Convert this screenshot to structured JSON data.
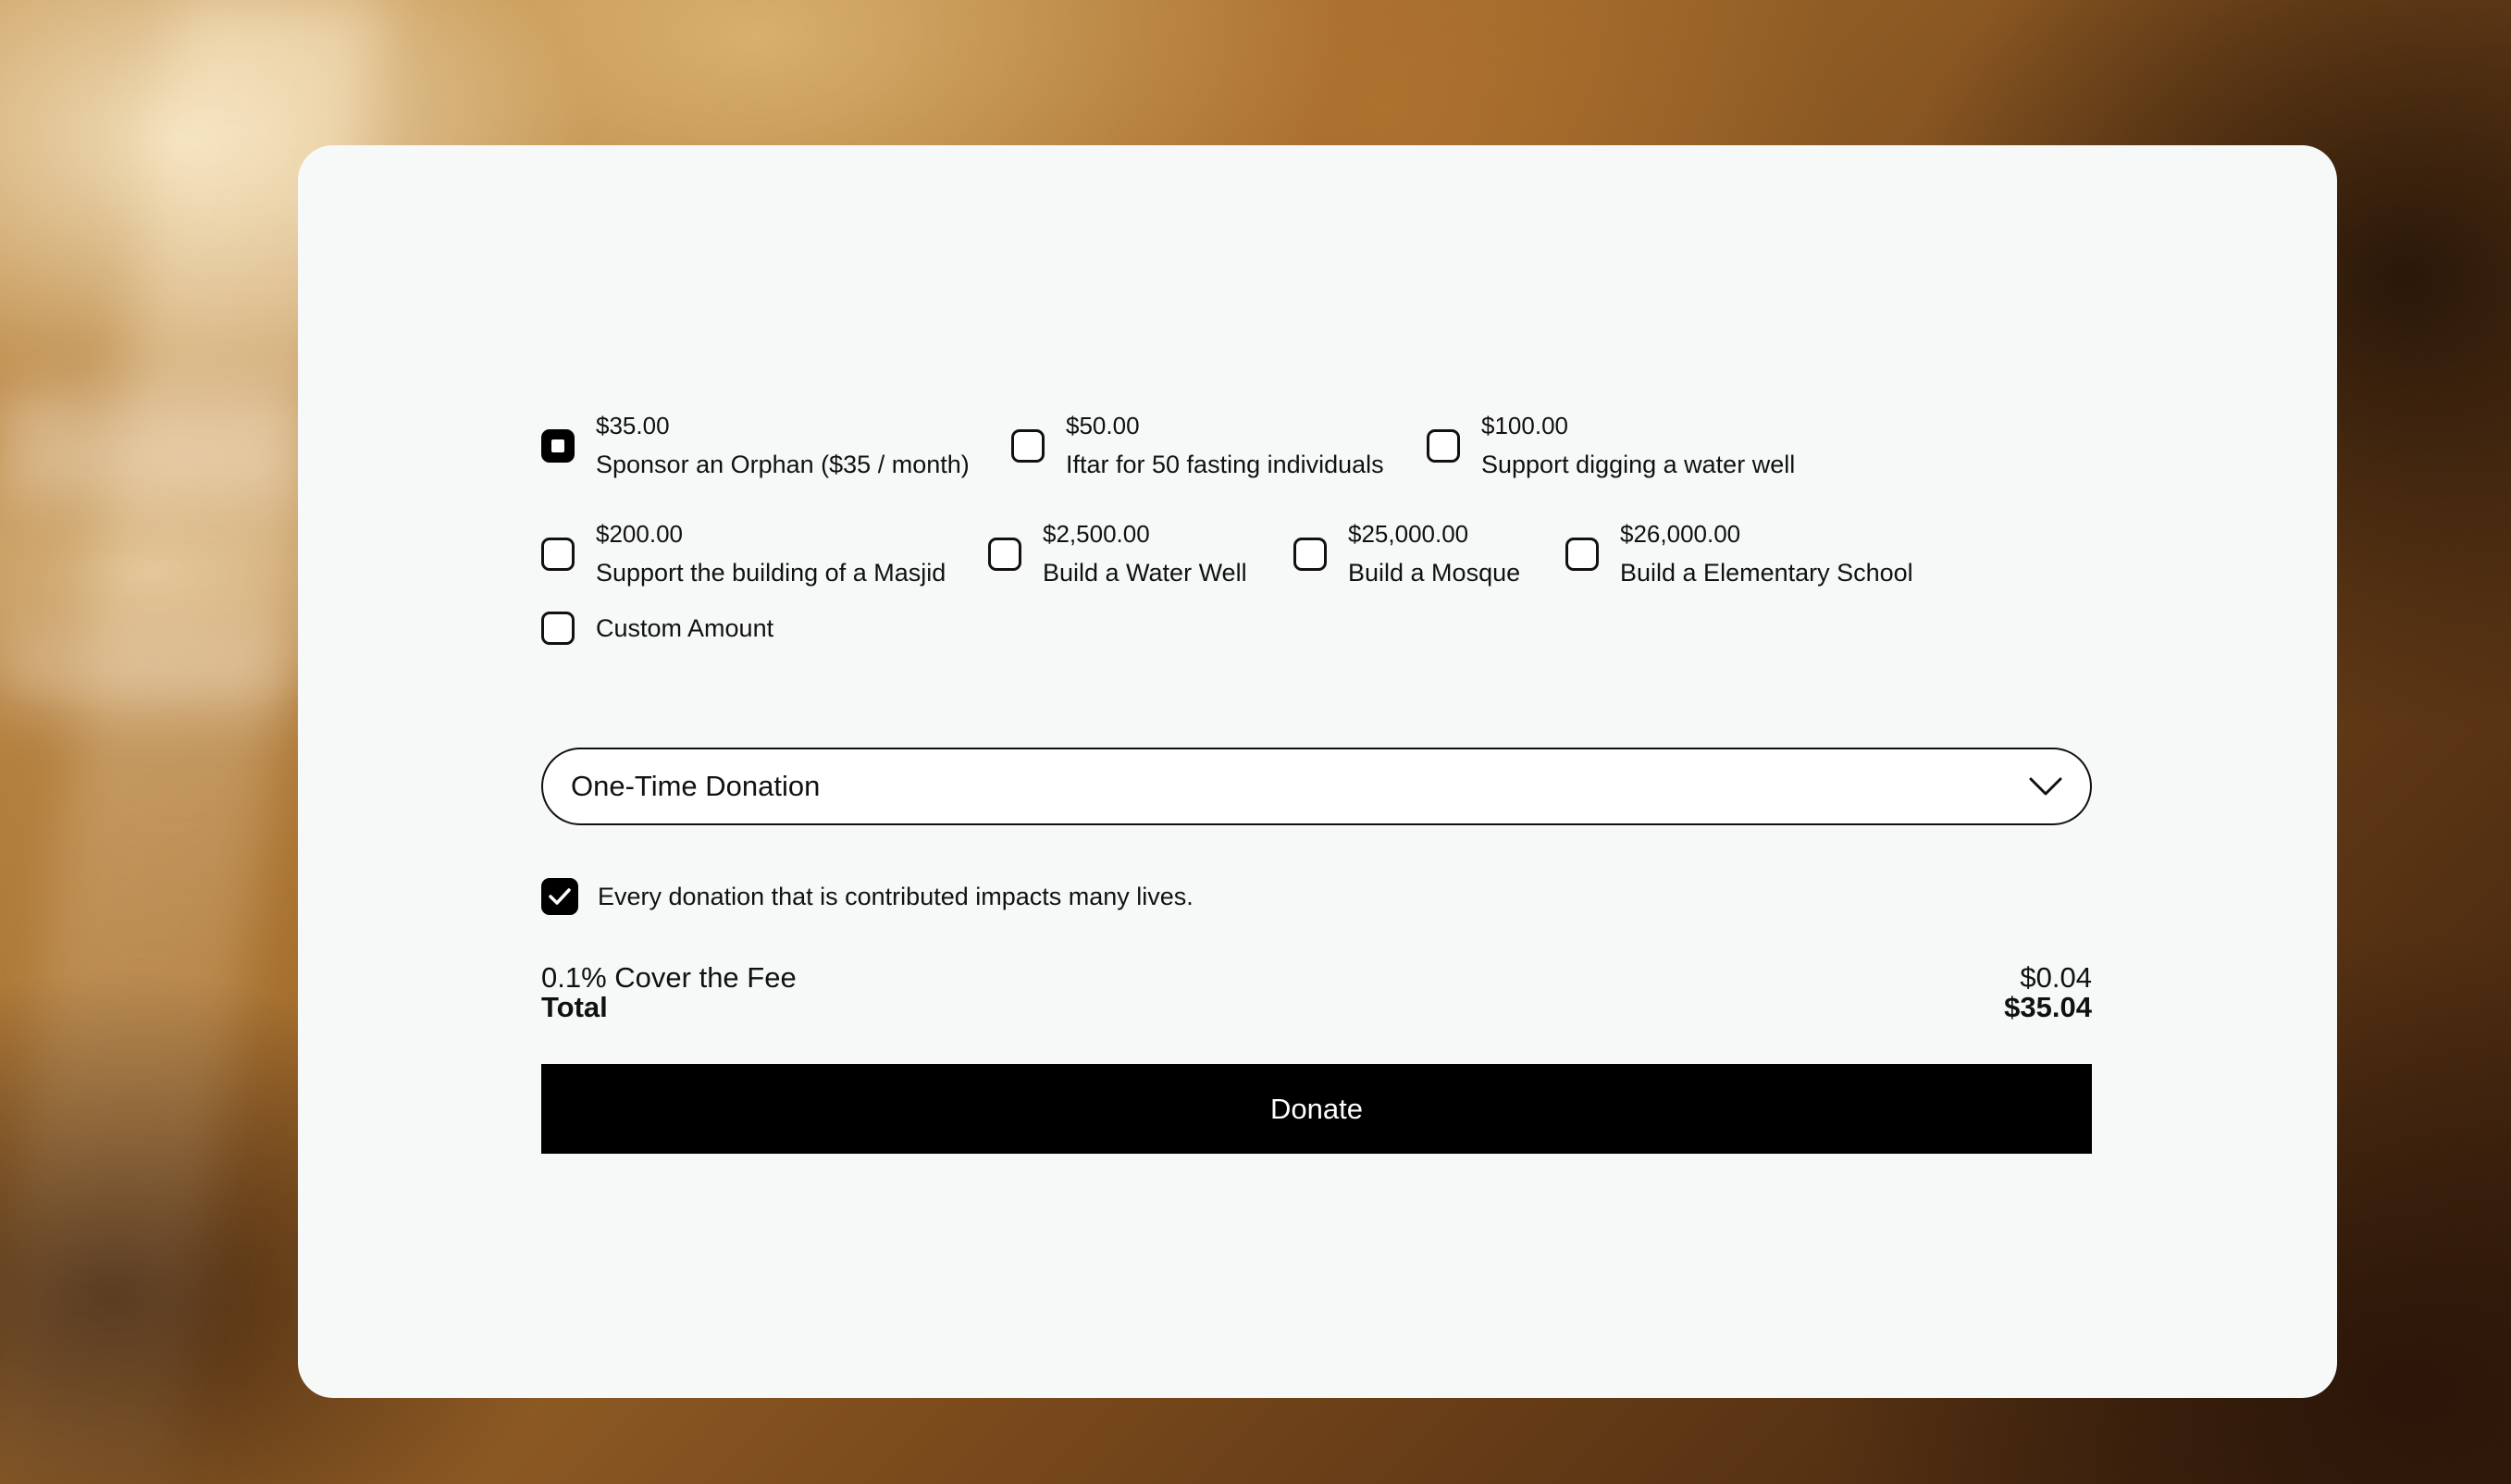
{
  "options": [
    {
      "amount": "$35.00",
      "label": "Sponsor an Orphan ($35 / month)",
      "selected": true
    },
    {
      "amount": "$50.00",
      "label": "Iftar for 50 fasting individuals",
      "selected": false
    },
    {
      "amount": "$100.00",
      "label": "Support digging a water well",
      "selected": false
    },
    {
      "amount": "$200.00",
      "label": "Support the building of a Masjid",
      "selected": false
    },
    {
      "amount": "$2,500.00",
      "label": "Build a Water Well",
      "selected": false
    },
    {
      "amount": "$25,000.00",
      "label": "Build a Mosque",
      "selected": false
    },
    {
      "amount": "$26,000.00",
      "label": "Build a Elementary School",
      "selected": false
    }
  ],
  "custom_amount": {
    "label": "Custom Amount",
    "selected": false
  },
  "frequency": {
    "value": "One-Time Donation",
    "icon": "chevron-down-icon"
  },
  "impact": {
    "checked": true,
    "text": "Every donation that is contributed impacts many lives.",
    "icon": "checkmark-icon"
  },
  "fee": {
    "label": "0.1% Cover the Fee",
    "amount": "$0.04"
  },
  "total": {
    "label": "Total",
    "amount": "$35.04"
  },
  "donate_button": {
    "label": "Donate"
  },
  "colors": {
    "card": "#f7f9f8",
    "accent": "#000000",
    "text": "#111111"
  }
}
